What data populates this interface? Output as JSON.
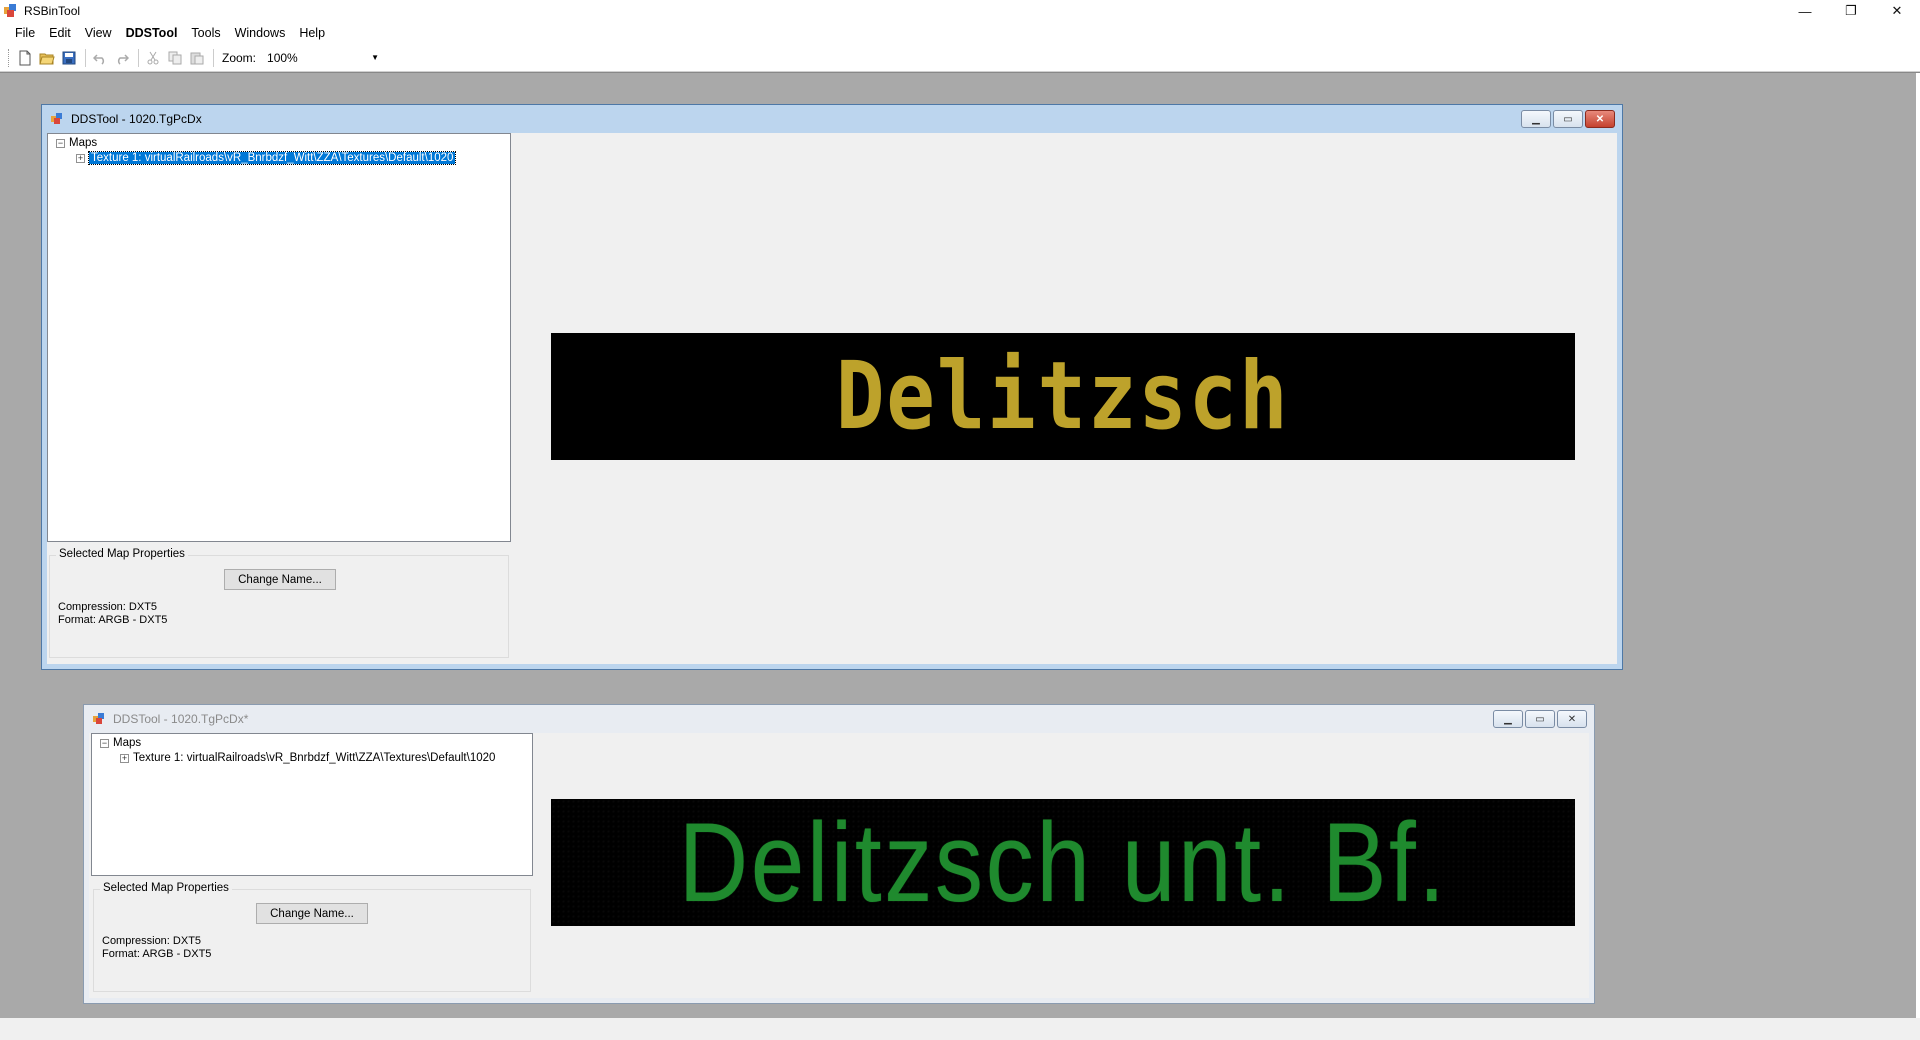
{
  "app": {
    "title": "RSBinTool",
    "controls": {
      "minimize": "—",
      "restore": "❐",
      "close": "✕"
    }
  },
  "menu": [
    {
      "label": "File"
    },
    {
      "label": "Edit"
    },
    {
      "label": "View"
    },
    {
      "label": "DDSTool"
    },
    {
      "label": "Tools"
    },
    {
      "label": "Windows"
    },
    {
      "label": "Help"
    }
  ],
  "toolbar": {
    "zoom_label": "Zoom:",
    "zoom_value": "100%"
  },
  "windows": [
    {
      "title": "DDSTool - 1020.TgPcDx",
      "tree_root": "Maps",
      "tree_child": "Texture 1: virtualRailroads\\vR_Bnrbdzf_Witt\\ZZA\\Textures\\Default\\1020",
      "group_title": "Selected Map Properties",
      "change_name": "Change Name...",
      "compression": "Compression: DXT5",
      "format": "Format: ARGB - DXT5",
      "preview_text": "Delitzsch",
      "preview_color": "#bda22b"
    },
    {
      "title": "DDSTool - 1020.TgPcDx*",
      "tree_root": "Maps",
      "tree_child": "Texture 1: virtualRailroads\\vR_Bnrbdzf_Witt\\ZZA\\Textures\\Default\\1020",
      "group_title": "Selected Map Properties",
      "change_name": "Change Name...",
      "compression": "Compression: DXT5",
      "format": "Format: ARGB - DXT5",
      "preview_text": "Delitzsch unt. Bf.",
      "preview_color": "#1f8a2e"
    }
  ]
}
